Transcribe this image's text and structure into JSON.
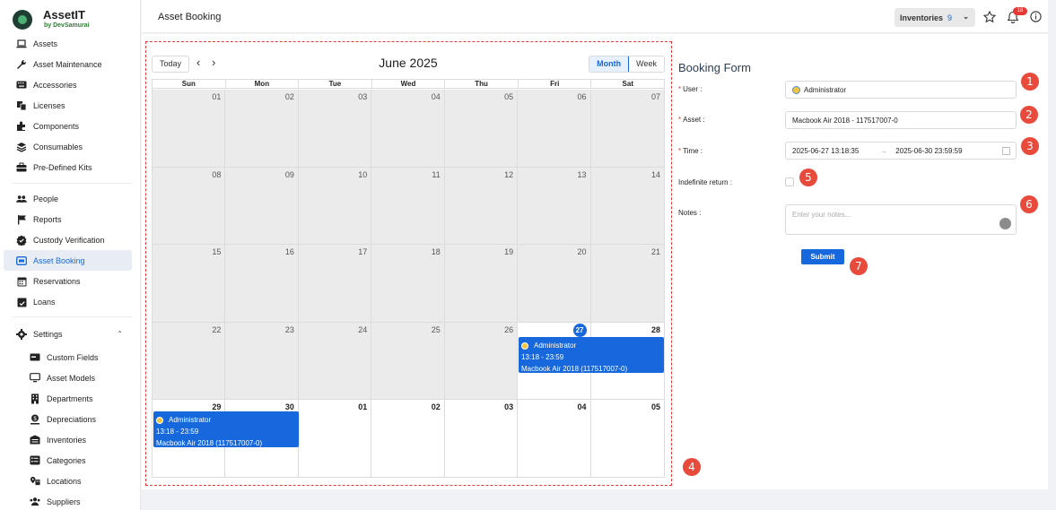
{
  "app": {
    "name": "AssetIT",
    "byline": "by DevSamurai"
  },
  "header": {
    "title": "Asset Booking",
    "inventory_label": "Inventories",
    "inventory_count": "9",
    "notification_count": "18"
  },
  "sidebar": {
    "items": [
      {
        "label": "Assets",
        "icon": "laptop-icon"
      },
      {
        "label": "Asset Maintenance",
        "icon": "wrench-icon"
      },
      {
        "label": "Accessories",
        "icon": "keyboard-icon"
      },
      {
        "label": "Licenses",
        "icon": "license-icon"
      },
      {
        "label": "Components",
        "icon": "puzzle-icon"
      },
      {
        "label": "Consumables",
        "icon": "layers-icon"
      },
      {
        "label": "Pre-Defined Kits",
        "icon": "toolbox-icon"
      },
      {
        "label": "People",
        "icon": "people-icon"
      },
      {
        "label": "Reports",
        "icon": "flag-icon"
      },
      {
        "label": "Custody Verification",
        "icon": "verified-icon"
      },
      {
        "label": "Asset Booking",
        "icon": "booking-icon",
        "active": true
      },
      {
        "label": "Reservations",
        "icon": "calendar-icon"
      },
      {
        "label": "Loans",
        "icon": "calendar-check-icon"
      },
      {
        "label": "Settings",
        "icon": "gear-icon"
      },
      {
        "label": "Custom Fields",
        "icon": "field-icon"
      },
      {
        "label": "Asset Models",
        "icon": "monitor-icon"
      },
      {
        "label": "Departments",
        "icon": "building-icon"
      },
      {
        "label": "Depreciations",
        "icon": "depreciation-icon"
      },
      {
        "label": "Inventories",
        "icon": "inventory-icon"
      },
      {
        "label": "Categories",
        "icon": "category-icon"
      },
      {
        "label": "Locations",
        "icon": "location-icon"
      },
      {
        "label": "Suppliers",
        "icon": "supplier-icon"
      }
    ]
  },
  "calendar": {
    "today_label": "Today",
    "title": "June 2025",
    "views": [
      "Month",
      "Week"
    ],
    "active_view": "Month",
    "weekdays": [
      "Sun",
      "Mon",
      "Tue",
      "Wed",
      "Thu",
      "Fri",
      "Sat"
    ],
    "weeks": [
      [
        "01",
        "02",
        "03",
        "04",
        "05",
        "06",
        "07"
      ],
      [
        "08",
        "09",
        "10",
        "11",
        "12",
        "13",
        "14"
      ],
      [
        "15",
        "16",
        "17",
        "18",
        "19",
        "20",
        "21"
      ],
      [
        "22",
        "23",
        "24",
        "25",
        "26",
        "27",
        "28"
      ],
      [
        "29",
        "30",
        "01",
        "02",
        "03",
        "04",
        "05"
      ]
    ],
    "today": "27",
    "events": [
      {
        "user": "Administrator",
        "time": "13:18 - 23:59",
        "asset": "Macbook Air 2018 (117517007-0)"
      },
      {
        "user": "Administrator",
        "time": "13:18 - 23:59",
        "asset": "Macbook Air 2018 (117517007-0)"
      }
    ]
  },
  "form": {
    "title": "Booking Form",
    "user_label": "User",
    "user_value": "Administrator",
    "asset_label": "Asset",
    "asset_value": "Macbook Air 2018 - 117517007-0",
    "time_label": "Time",
    "time_start": "2025-06-27 13:18:35",
    "time_end": "2025-06-30 23:59:59",
    "indefinite_label": "Indefinite return",
    "notes_label": "Notes",
    "notes_placeholder": "Enter your notes...",
    "submit_label": "Submit"
  },
  "markers": [
    "1",
    "2",
    "3",
    "4",
    "5",
    "6",
    "7"
  ],
  "colors": {
    "primary": "#1668dc",
    "marker": "#e84a3c",
    "past_day": "#ebebeb"
  }
}
